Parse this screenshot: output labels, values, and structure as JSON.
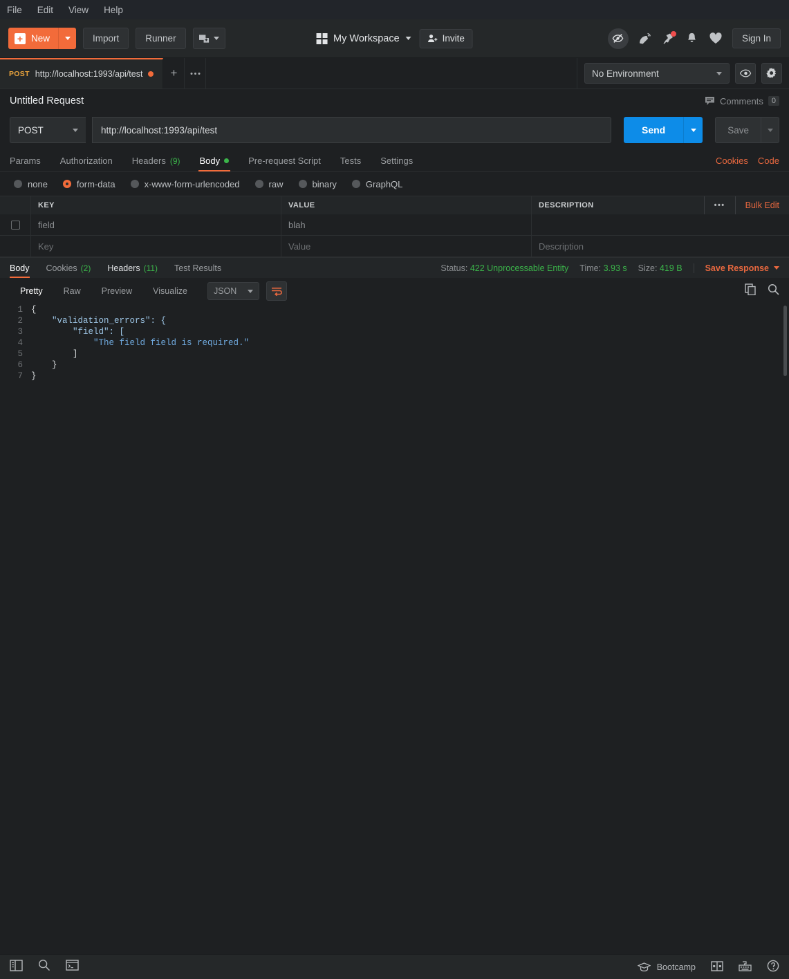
{
  "menubar": {
    "items": [
      "File",
      "Edit",
      "View",
      "Help"
    ]
  },
  "toolbar": {
    "new_label": "New",
    "import_label": "Import",
    "runner_label": "Runner",
    "new_window_icon": "new-window-icon",
    "workspace_label": "My Workspace",
    "invite_label": "Invite",
    "signin_label": "Sign In",
    "icons": [
      "interceptor-off-icon",
      "satellite-icon",
      "pin-notification-icon",
      "bell-icon",
      "heart-icon"
    ]
  },
  "tabstrip": {
    "tab": {
      "method": "POST",
      "title": "http://localhost:1993/api/test",
      "unsaved": true
    },
    "new_tab_icon": "plus-icon",
    "more_tabs_icon": "ellipsis-icon",
    "environment": "No Environment",
    "eye_icon": "eye-icon",
    "settings_icon": "gear-icon"
  },
  "request": {
    "title": "Untitled Request",
    "comments_label": "Comments",
    "comments_count": "0",
    "method": "POST",
    "url": "http://localhost:1993/api/test",
    "send_label": "Send",
    "save_label": "Save",
    "tabs": [
      {
        "label": "Params",
        "count": "",
        "active": false,
        "dot": false
      },
      {
        "label": "Authorization",
        "count": "",
        "active": false,
        "dot": false
      },
      {
        "label": "Headers",
        "count": "(9)",
        "active": false,
        "dot": false
      },
      {
        "label": "Body",
        "count": "",
        "active": true,
        "dot": true
      },
      {
        "label": "Pre-request Script",
        "count": "",
        "active": false,
        "dot": false
      },
      {
        "label": "Tests",
        "count": "",
        "active": false,
        "dot": false
      },
      {
        "label": "Settings",
        "count": "",
        "active": false,
        "dot": false
      }
    ],
    "links": [
      "Cookies",
      "Code"
    ],
    "body_types": [
      {
        "label": "none",
        "selected": false
      },
      {
        "label": "form-data",
        "selected": true
      },
      {
        "label": "x-www-form-urlencoded",
        "selected": false
      },
      {
        "label": "raw",
        "selected": false
      },
      {
        "label": "binary",
        "selected": false
      },
      {
        "label": "GraphQL",
        "selected": false
      }
    ],
    "table": {
      "headers": [
        "KEY",
        "VALUE",
        "DESCRIPTION"
      ],
      "dots_label": "•••",
      "bulk_edit_label": "Bulk Edit",
      "rows": [
        {
          "checked": false,
          "key": "field",
          "value": "blah",
          "description": "",
          "placeholder": false
        },
        {
          "checked": false,
          "key": "Key",
          "value": "Value",
          "description": "Description",
          "placeholder": true
        }
      ]
    }
  },
  "response": {
    "tabs": [
      {
        "label": "Body",
        "count": "",
        "active": true
      },
      {
        "label": "Cookies",
        "count": "(2)",
        "active": false
      },
      {
        "label": "Headers",
        "count": "(11)",
        "active": false
      },
      {
        "label": "Test Results",
        "count": "",
        "active": false
      }
    ],
    "status_label": "Status:",
    "status_value": "422 Unprocessable Entity",
    "time_label": "Time:",
    "time_value": "3.93 s",
    "size_label": "Size:",
    "size_value": "419 B",
    "save_response_label": "Save Response",
    "formats": [
      {
        "label": "Pretty",
        "active": true
      },
      {
        "label": "Raw",
        "active": false
      },
      {
        "label": "Preview",
        "active": false
      },
      {
        "label": "Visualize",
        "active": false
      }
    ],
    "language": "JSON",
    "wrap_icon": "word-wrap-icon",
    "copy_icon": "copy-icon",
    "search_icon": "search-icon",
    "body_lines": [
      {
        "n": "1",
        "text": "{"
      },
      {
        "n": "2",
        "text": "    \"validation_errors\": {"
      },
      {
        "n": "3",
        "text": "        \"field\": ["
      },
      {
        "n": "4",
        "text": "            \"The field field is required.\""
      },
      {
        "n": "5",
        "text": "        ]"
      },
      {
        "n": "6",
        "text": "    }"
      },
      {
        "n": "7",
        "text": "}"
      }
    ]
  },
  "footer": {
    "left_icons": [
      "sidebar-toggle-icon",
      "search-icon",
      "console-icon"
    ],
    "bootcamp_label": "Bootcamp",
    "right_icons": [
      "layout-toggle-icon",
      "keyboard-shortcuts-icon",
      "help-icon"
    ]
  },
  "colors": {
    "accent": "#f26b3a",
    "send": "#0d8ce8",
    "success": "#3bb54a",
    "method": "#e8a33d",
    "background": "#1e2022"
  }
}
